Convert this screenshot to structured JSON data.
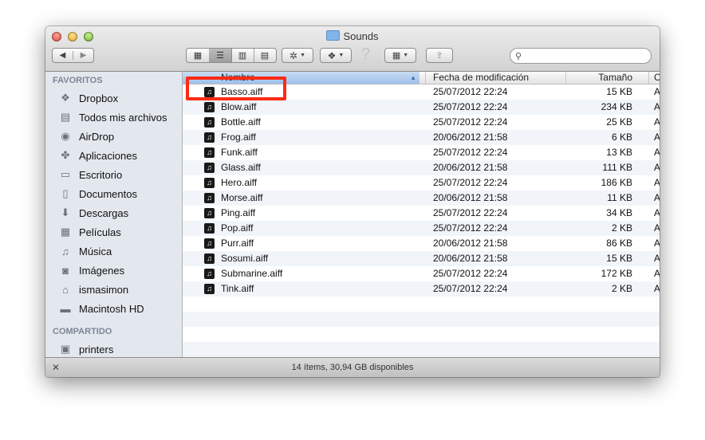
{
  "window": {
    "title": "Sounds"
  },
  "toolbar": {
    "back_icon": "back-arrow-icon",
    "forward_icon": "forward-arrow-icon",
    "views": [
      "icon-view",
      "list-view",
      "column-view",
      "coverflow-view"
    ],
    "action_icon": "gear-icon",
    "dropbox_icon": "dropbox-icon",
    "help_glyph": "?",
    "arrange_icon": "arrange-icon",
    "share_icon": "share-icon",
    "search_placeholder": ""
  },
  "sidebar": {
    "favorites_title": "FAVORITOS",
    "favorites": [
      {
        "label": "Dropbox",
        "icon": "dropbox-icon"
      },
      {
        "label": "Todos mis archivos",
        "icon": "all-files-icon"
      },
      {
        "label": "AirDrop",
        "icon": "airdrop-icon"
      },
      {
        "label": "Aplicaciones",
        "icon": "applications-icon"
      },
      {
        "label": "Escritorio",
        "icon": "desktop-icon"
      },
      {
        "label": "Documentos",
        "icon": "documents-icon"
      },
      {
        "label": "Descargas",
        "icon": "downloads-icon"
      },
      {
        "label": "Películas",
        "icon": "movies-icon"
      },
      {
        "label": "Música",
        "icon": "music-icon"
      },
      {
        "label": "Imágenes",
        "icon": "pictures-icon"
      },
      {
        "label": "ismasimon",
        "icon": "home-icon"
      },
      {
        "label": "Macintosh HD",
        "icon": "disk-icon"
      }
    ],
    "shared_title": "COMPARTIDO",
    "shared": [
      {
        "label": "printers",
        "icon": "computer-icon"
      }
    ]
  },
  "columns": {
    "name": "Nombre",
    "date": "Fecha de modificación",
    "size": "Tamaño",
    "kind": "C"
  },
  "files": [
    {
      "name": "Basso.aiff",
      "date": "25/07/2012 22:24",
      "size": "15 KB",
      "kind": "A"
    },
    {
      "name": "Blow.aiff",
      "date": "25/07/2012 22:24",
      "size": "234 KB",
      "kind": "A"
    },
    {
      "name": "Bottle.aiff",
      "date": "25/07/2012 22:24",
      "size": "25 KB",
      "kind": "A"
    },
    {
      "name": "Frog.aiff",
      "date": "20/06/2012 21:58",
      "size": "6 KB",
      "kind": "A"
    },
    {
      "name": "Funk.aiff",
      "date": "25/07/2012 22:24",
      "size": "13 KB",
      "kind": "A"
    },
    {
      "name": "Glass.aiff",
      "date": "20/06/2012 21:58",
      "size": "111 KB",
      "kind": "A"
    },
    {
      "name": "Hero.aiff",
      "date": "25/07/2012 22:24",
      "size": "186 KB",
      "kind": "A"
    },
    {
      "name": "Morse.aiff",
      "date": "20/06/2012 21:58",
      "size": "11 KB",
      "kind": "A"
    },
    {
      "name": "Ping.aiff",
      "date": "25/07/2012 22:24",
      "size": "34 KB",
      "kind": "A"
    },
    {
      "name": "Pop.aiff",
      "date": "25/07/2012 22:24",
      "size": "2 KB",
      "kind": "A"
    },
    {
      "name": "Purr.aiff",
      "date": "20/06/2012 21:58",
      "size": "86 KB",
      "kind": "A"
    },
    {
      "name": "Sosumi.aiff",
      "date": "20/06/2012 21:58",
      "size": "15 KB",
      "kind": "A"
    },
    {
      "name": "Submarine.aiff",
      "date": "25/07/2012 22:24",
      "size": "172 KB",
      "kind": "A"
    },
    {
      "name": "Tink.aiff",
      "date": "25/07/2012 22:24",
      "size": "2 KB",
      "kind": "A"
    }
  ],
  "status": {
    "text": "14 ítems, 30,94 GB disponibles"
  },
  "highlight": {
    "color": "#ff2a14",
    "target": "Basso.aiff"
  }
}
